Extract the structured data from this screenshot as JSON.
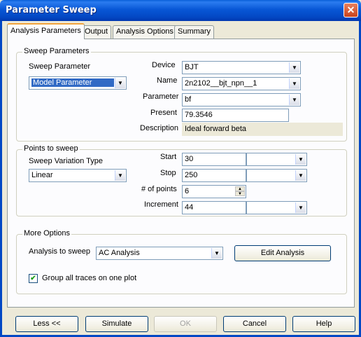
{
  "window": {
    "title": "Parameter Sweep",
    "close_glyph": "✕"
  },
  "tabs": [
    {
      "label": "Analysis Parameters"
    },
    {
      "label": "Output"
    },
    {
      "label": "Analysis Options"
    },
    {
      "label": "Summary"
    }
  ],
  "sweep_parameters": {
    "title": "Sweep Parameters",
    "sweep_parameter_label": "Sweep Parameter",
    "sweep_parameter_value": "Model Parameter",
    "device_label": "Device",
    "device_value": "BJT",
    "name_label": "Name",
    "name_value": "2n2102__bjt_npn__1",
    "parameter_label": "Parameter",
    "parameter_value": "bf",
    "present_label": "Present",
    "present_value": "79.3546",
    "description_label": "Description",
    "description_value": "Ideal forward beta"
  },
  "points_to_sweep": {
    "title": "Points to sweep",
    "variation_type_label": "Sweep Variation Type",
    "variation_type_value": "Linear",
    "start_label": "Start",
    "start_value": "30",
    "stop_label": "Stop",
    "stop_value": "250",
    "num_points_label": "# of points",
    "num_points_value": "6",
    "increment_label": "Increment",
    "increment_value": "44"
  },
  "more_options": {
    "title": "More Options",
    "analysis_label": "Analysis to sweep",
    "analysis_value": "AC Analysis",
    "edit_button": "Edit Analysis",
    "group_traces_label": "Group all traces on one plot",
    "group_traces_checked": true
  },
  "footer": {
    "less_button": "Less <<",
    "simulate_button": "Simulate",
    "ok_button": "OK",
    "cancel_button": "Cancel",
    "help_button": "Help"
  },
  "icons": {
    "dropdown_arrow": "▼",
    "spin_up": "▲",
    "spin_down": "▼",
    "check": "✔"
  }
}
